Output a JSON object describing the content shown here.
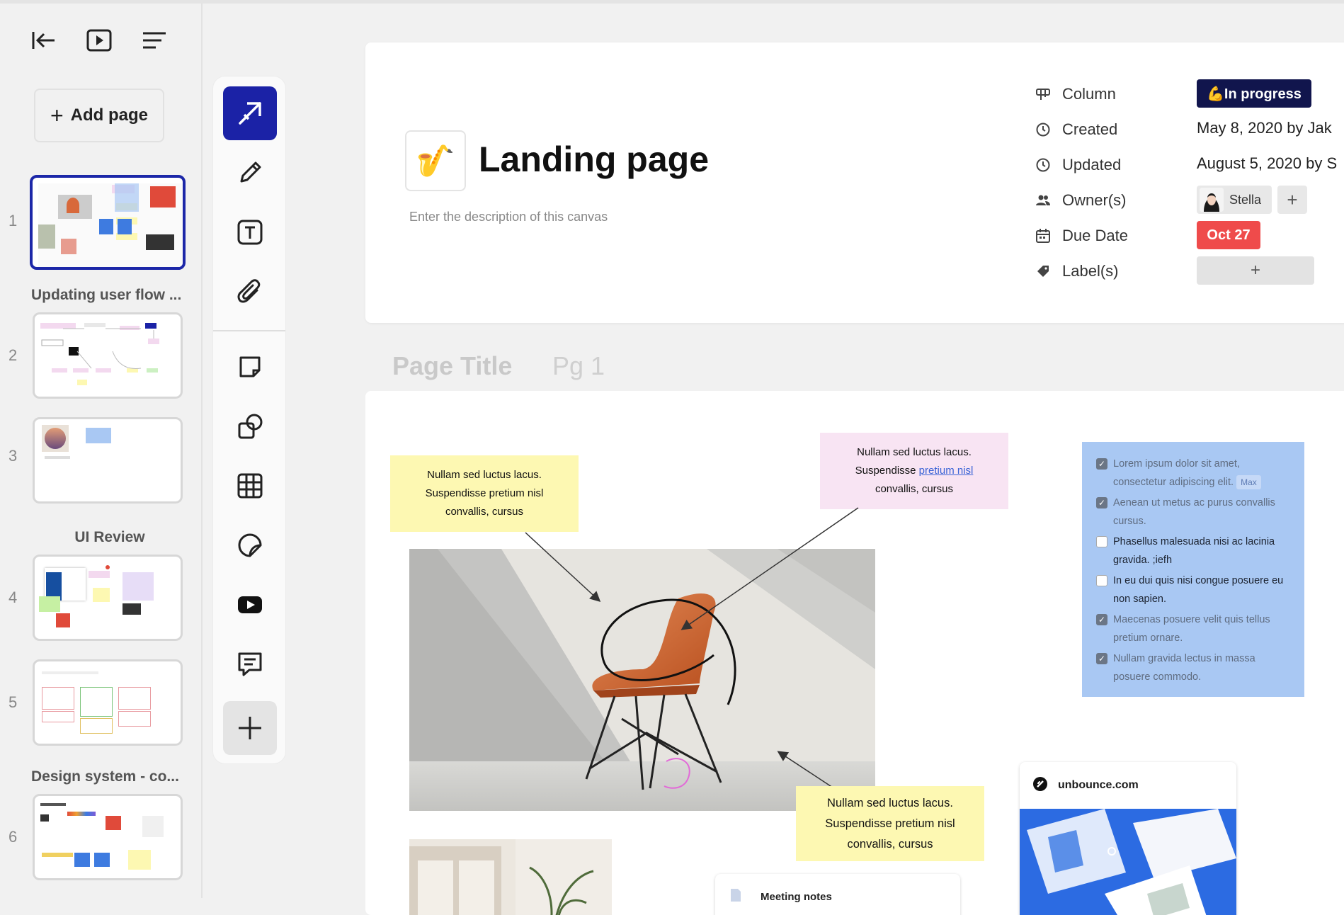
{
  "sidebar": {
    "add_page_label": "Add page",
    "pages": [
      {
        "number": "1",
        "title": ""
      },
      {
        "number": "2",
        "title": "Updating user flow ..."
      },
      {
        "number": "3",
        "title": ""
      },
      {
        "number": "4",
        "title": "UI Review"
      },
      {
        "number": "5",
        "title": ""
      },
      {
        "number": "6",
        "title": "Design system - co..."
      }
    ]
  },
  "header": {
    "emoji": "🎷",
    "title": "Landing page",
    "description_placeholder": "Enter the description of this canvas",
    "properties": {
      "column_label": "Column",
      "column_value": "💪In progress",
      "created_label": "Created",
      "created_value": "May 8, 2020 by Jak",
      "updated_label": "Updated",
      "updated_value": "August 5, 2020 by S",
      "owners_label": "Owner(s)",
      "owner_name": "Stella",
      "due_label": "Due Date",
      "due_value": "Oct 27",
      "labels_label": "Label(s)"
    }
  },
  "page": {
    "title": "Page Title",
    "number": "Pg 1"
  },
  "canvas": {
    "sticky_top_left": [
      "Nullam sed luctus lacus.",
      "Suspendisse pretium nisl",
      "convallis, cursus"
    ],
    "sticky_pink": {
      "line1": "Nullam sed luctus lacus.",
      "line2_pre": "Suspendisse ",
      "line2_link": "pretium nisl",
      "line3": "convallis, cursus"
    },
    "sticky_bottom": [
      "Nullam sed luctus lacus.",
      "Suspendisse pretium nisl",
      "convallis, cursus"
    ],
    "checklist": [
      {
        "text": "Lorem ipsum dolor sit amet, consectetur adipiscing elit.",
        "checked": true,
        "tag": "Max"
      },
      {
        "text": "Aenean ut metus ac purus convallis cursus.",
        "checked": true
      },
      {
        "text": "Phasellus malesuada nisi ac lacinia gravida. ;iefh",
        "checked": false
      },
      {
        "text": "In eu dui quis nisi congue posuere eu non sapien.",
        "checked": false
      },
      {
        "text": "Maecenas posuere velit quis tellus pretium ornare.",
        "checked": true
      },
      {
        "text": "Nullam gravida lectus in massa posuere commodo.",
        "checked": true
      }
    ],
    "link_card_domain": "unbounce.com",
    "meeting_title": "Meeting notes"
  },
  "colors": {
    "accent": "#1b22a6",
    "status_in_progress": "#11154d",
    "due_red": "#ef4b4b",
    "sticky_yellow": "#fdf8b2",
    "sticky_pink": "#f8e4f3",
    "checklist_blue": "#a9c8f3"
  },
  "icons": {
    "toolbar": [
      "select-arrow-icon",
      "pencil-icon",
      "text-icon",
      "attachment-icon",
      "sticky-note-icon",
      "shapes-icon",
      "table-icon",
      "sticker-icon",
      "video-icon",
      "comment-icon",
      "plus-icon"
    ]
  }
}
